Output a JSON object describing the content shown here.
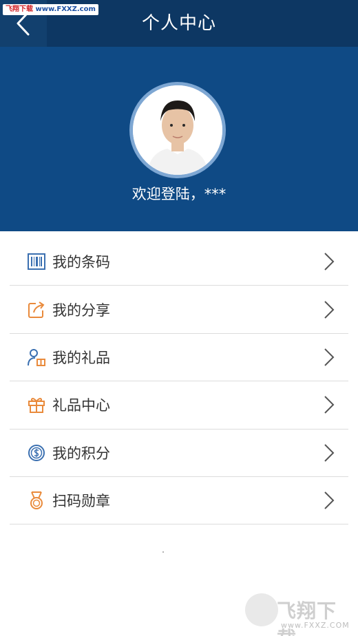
{
  "watermark_top": {
    "brand": "飞翔下载",
    "url": "www.FXXZ.com"
  },
  "header": {
    "title": "个人中心",
    "back_icon": "chevron-left-icon"
  },
  "profile": {
    "welcome": "欢迎登陆，***"
  },
  "menu": {
    "items": [
      {
        "label": "我的条码",
        "icon": "barcode-icon",
        "icon_color": "#3a6fb0"
      },
      {
        "label": "我的分享",
        "icon": "share-icon",
        "icon_color": "#e98a3b"
      },
      {
        "label": "我的礼品",
        "icon": "user-gift-icon",
        "icon_color": "#3a6fb0"
      },
      {
        "label": "礼品中心",
        "icon": "gift-icon",
        "icon_color": "#e98a3b"
      },
      {
        "label": "我的积分",
        "icon": "coin-icon",
        "icon_color": "#3a6fb0"
      },
      {
        "label": "扫码勋章",
        "icon": "medal-icon",
        "icon_color": "#e98a3b"
      }
    ]
  },
  "watermark_bottom": {
    "brand": "飞翔下载",
    "url": "www.FXXZ.COM"
  },
  "colors": {
    "topbar": "#0d3763",
    "hero": "#0f4a85",
    "accent_blue": "#3a6fb0",
    "accent_orange": "#e98a3b"
  }
}
